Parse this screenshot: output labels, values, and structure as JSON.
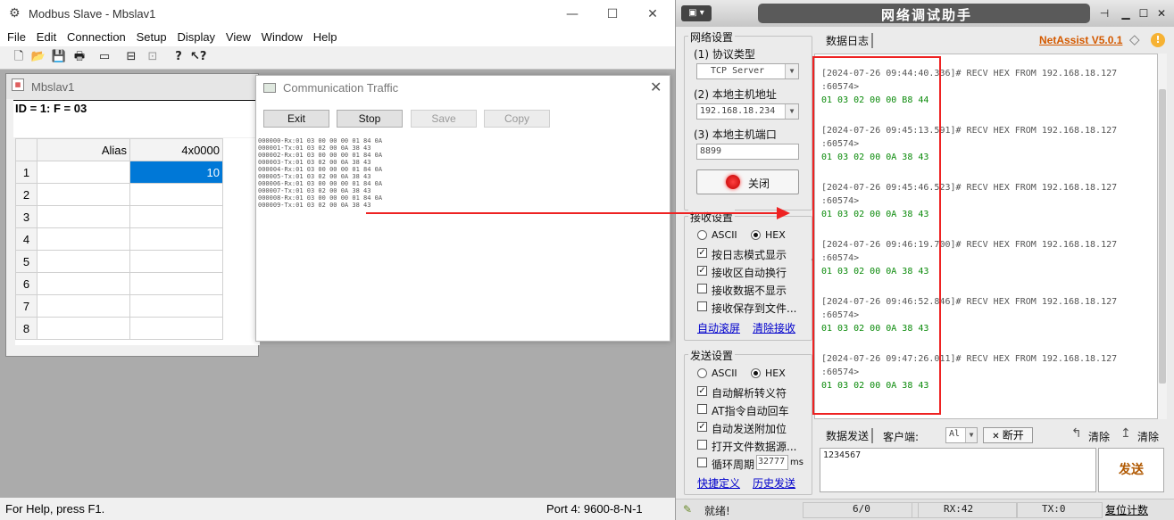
{
  "modbus_slave": {
    "title": "Modbus Slave - Mbslav1",
    "menu": [
      "File",
      "Edit",
      "Connection",
      "Setup",
      "Display",
      "View",
      "Window",
      "Help"
    ],
    "child": {
      "title": "Mbslav1",
      "header": "ID = 1: F = 03",
      "columns": [
        "",
        "Alias",
        "4x0000"
      ],
      "rows": [
        {
          "n": "1",
          "alias": "",
          "value": "10"
        },
        {
          "n": "2",
          "alias": "",
          "value": ""
        },
        {
          "n": "3",
          "alias": "",
          "value": ""
        },
        {
          "n": "4",
          "alias": "",
          "value": ""
        },
        {
          "n": "5",
          "alias": "",
          "value": ""
        },
        {
          "n": "6",
          "alias": "",
          "value": ""
        },
        {
          "n": "7",
          "alias": "",
          "value": ""
        },
        {
          "n": "8",
          "alias": "",
          "value": ""
        }
      ]
    },
    "traffic": {
      "title": "Communication Traffic",
      "buttons": {
        "exit": "Exit",
        "stop": "Stop",
        "save": "Save",
        "copy": "Copy"
      },
      "log": [
        "000000-Rx:01 03 00 00 00 01 84 0A",
        "000001-Tx:01 03 02 00 0A 38 43",
        "000002-Rx:01 03 00 00 00 01 84 0A",
        "000003-Tx:01 03 02 00 0A 38 43",
        "000004-Rx:01 03 00 00 00 01 84 0A",
        "000005-Tx:01 03 02 00 0A 38 43",
        "000006-Rx:01 03 00 00 00 01 84 0A",
        "000007-Tx:01 03 02 00 0A 38 43",
        "000008-Rx:01 03 00 00 00 01 84 0A",
        "000009-Tx:01 03 02 00 0A 38 43"
      ]
    },
    "status_left": "For Help, press F1.",
    "status_right": "Port 4: 9600-8-N-1"
  },
  "netassist": {
    "title": "网络调试助手",
    "brand": "NetAssist V5.0.1",
    "net_settings": {
      "group": "网络设置",
      "protocol_label": "(1) 协议类型",
      "protocol_value": "TCP Server",
      "host_label": "(2) 本地主机地址",
      "host_value": "192.168.18.234",
      "port_label": "(3) 本地主机端口",
      "port_value": "8899",
      "close_button": "关闭"
    },
    "recv_settings": {
      "group": "接收设置",
      "ascii": "ASCII",
      "hex": "HEX",
      "opt1": "按日志模式显示",
      "opt2": "接收区自动换行",
      "opt3": "接收数据不显示",
      "opt4": "接收保存到文件...",
      "link1": "自动滚屏",
      "link2": "清除接收"
    },
    "send_settings": {
      "group": "发送设置",
      "ascii": "ASCII",
      "hex": "HEX",
      "opt1": "自动解析转义符",
      "opt2": "AT指令自动回车",
      "opt3": "自动发送附加位",
      "opt4": "打开文件数据源...",
      "opt5": "循环周期",
      "period": "32777",
      "unit": "ms",
      "link1": "快捷定义",
      "link2": "历史发送"
    },
    "log_tab": "数据日志",
    "log_entries": [
      {
        "header": "[2024-07-26 09:44:40.336]# RECV HEX FROM 192.168.18.127",
        "port": ":60574>",
        "data": "01 03 02 00 00 B8 44"
      },
      {
        "header": "[2024-07-26 09:45:13.591]# RECV HEX FROM 192.168.18.127",
        "port": ":60574>",
        "data": "01 03 02 00 0A 38 43"
      },
      {
        "header": "[2024-07-26 09:45:46.523]# RECV HEX FROM 192.168.18.127",
        "port": ":60574>",
        "data": "01 03 02 00 0A 38 43"
      },
      {
        "header": "[2024-07-26 09:46:19.700]# RECV HEX FROM 192.168.18.127",
        "port": ":60574>",
        "data": "01 03 02 00 0A 38 43"
      },
      {
        "header": "[2024-07-26 09:46:52.846]# RECV HEX FROM 192.168.18.127",
        "port": ":60574>",
        "data": "01 03 02 00 0A 38 43"
      },
      {
        "header": "[2024-07-26 09:47:26.011]# RECV HEX FROM 192.168.18.127",
        "port": ":60574>",
        "data": "01 03 02 00 0A 38 43"
      }
    ],
    "send_bar": {
      "tab": "数据发送",
      "client_label": "客户端:",
      "client_value": "Al",
      "disconnect": "断开",
      "clear1": "清除",
      "clear2": "清除"
    },
    "send_text": "1234567",
    "send_button": "发送",
    "status": {
      "ready": "就绪!",
      "count": "6/0",
      "rx": "RX:42",
      "tx": "TX:0",
      "reset": "复位计数"
    }
  },
  "colors": {
    "selection": "#0078d7",
    "annotation": "#ee2222",
    "data_green": "#0a8a0a",
    "brand": "#d45a00"
  }
}
